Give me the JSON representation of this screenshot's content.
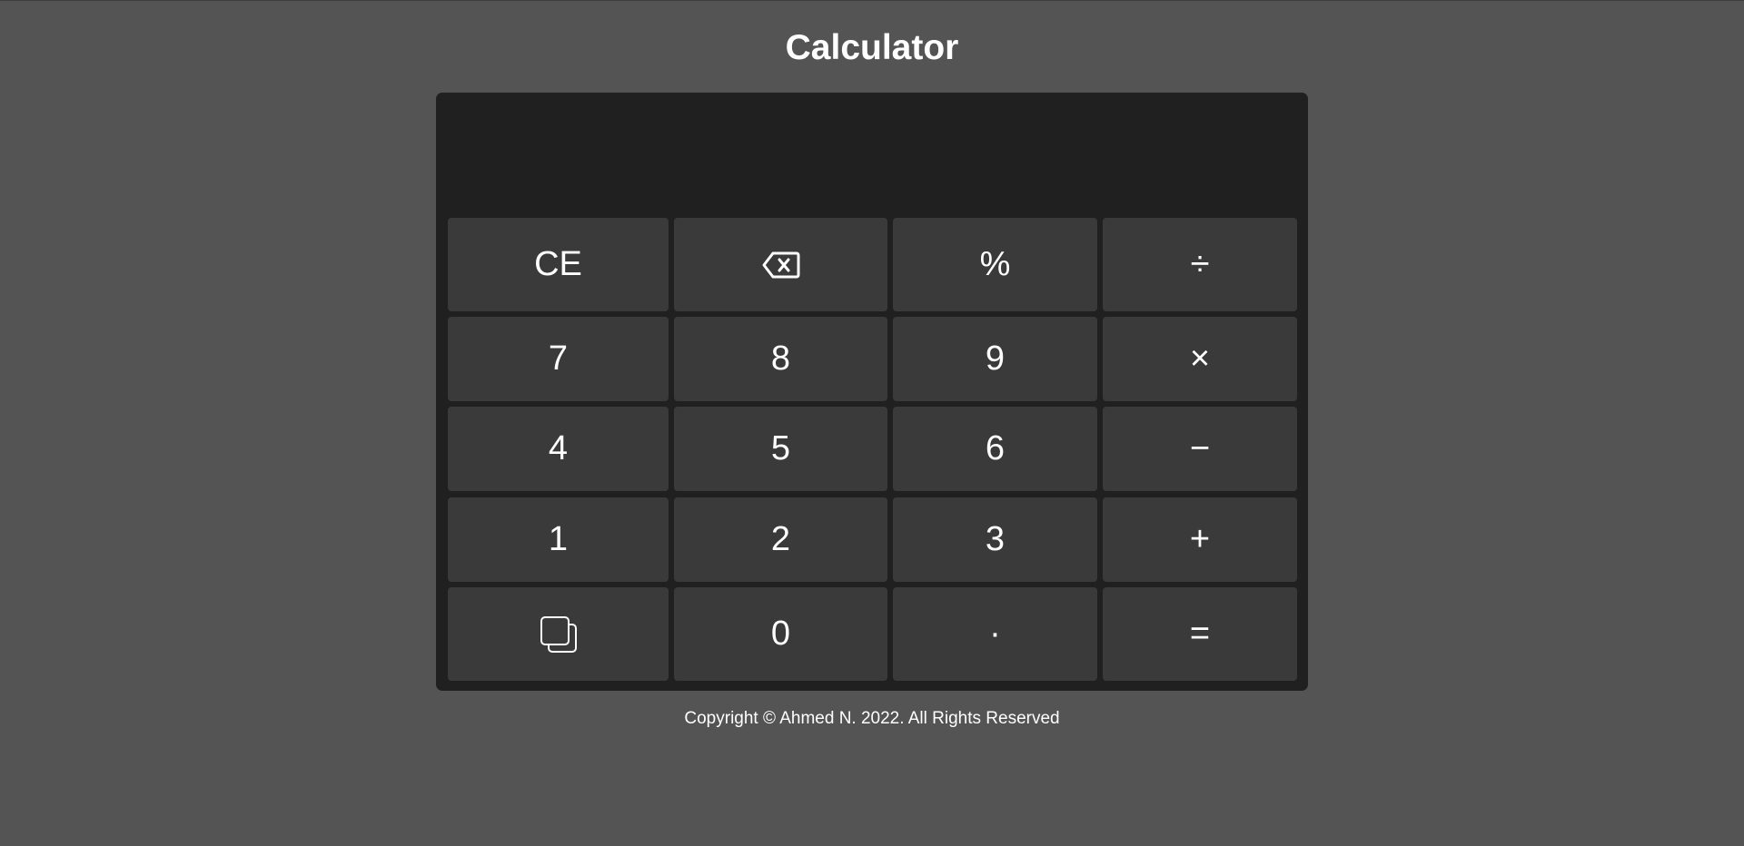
{
  "title": "Calculator",
  "display": {
    "value": ""
  },
  "keys": {
    "ce": "CE",
    "backspace_icon": "backspace-icon",
    "percent": "%",
    "divide": "÷",
    "seven": "7",
    "eight": "8",
    "nine": "9",
    "multiply": "×",
    "four": "4",
    "five": "5",
    "six": "6",
    "minus": "−",
    "one": "1",
    "two": "2",
    "three": "3",
    "plus": "+",
    "copy_icon": "copy-icon",
    "zero": "0",
    "decimal": "·",
    "equals": "="
  },
  "footer": {
    "text": "Copyright © Ahmed N. 2022. All Rights Reserved"
  },
  "colors": {
    "page_background": "#545454",
    "calculator_background": "#202020",
    "key_background": "#3a3a3a",
    "text": "#ffffff"
  }
}
